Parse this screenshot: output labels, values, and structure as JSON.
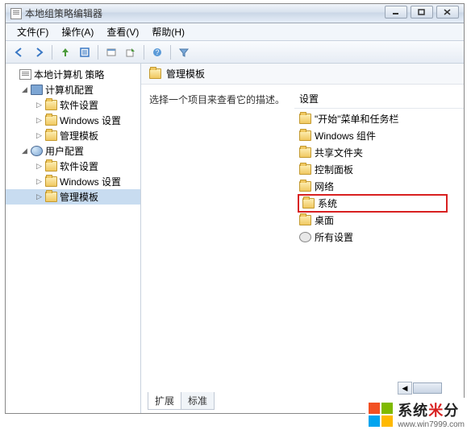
{
  "window": {
    "title": "本地组策略编辑器"
  },
  "menu": {
    "file": "文件(F)",
    "action": "操作(A)",
    "view": "查看(V)",
    "help": "帮助(H)"
  },
  "tree": {
    "root": "本地计算机 策略",
    "computer": "计算机配置",
    "user": "用户配置",
    "soft": "软件设置",
    "win": "Windows 设置",
    "admin": "管理模板"
  },
  "right": {
    "title": "管理模板",
    "hint": "选择一个项目来查看它的描述。",
    "col": "设置",
    "items": {
      "start": "\"开始\"菜单和任务栏",
      "wincomp": "Windows 组件",
      "shared": "共享文件夹",
      "cpl": "控制面板",
      "net": "网络",
      "sys": "系统",
      "desk": "桌面",
      "all": "所有设置"
    }
  },
  "tabs": {
    "ext": "扩展",
    "std": "标准"
  },
  "watermark": {
    "main_a": "系统",
    "main_b": "分",
    "url": "www.win7999.com"
  }
}
